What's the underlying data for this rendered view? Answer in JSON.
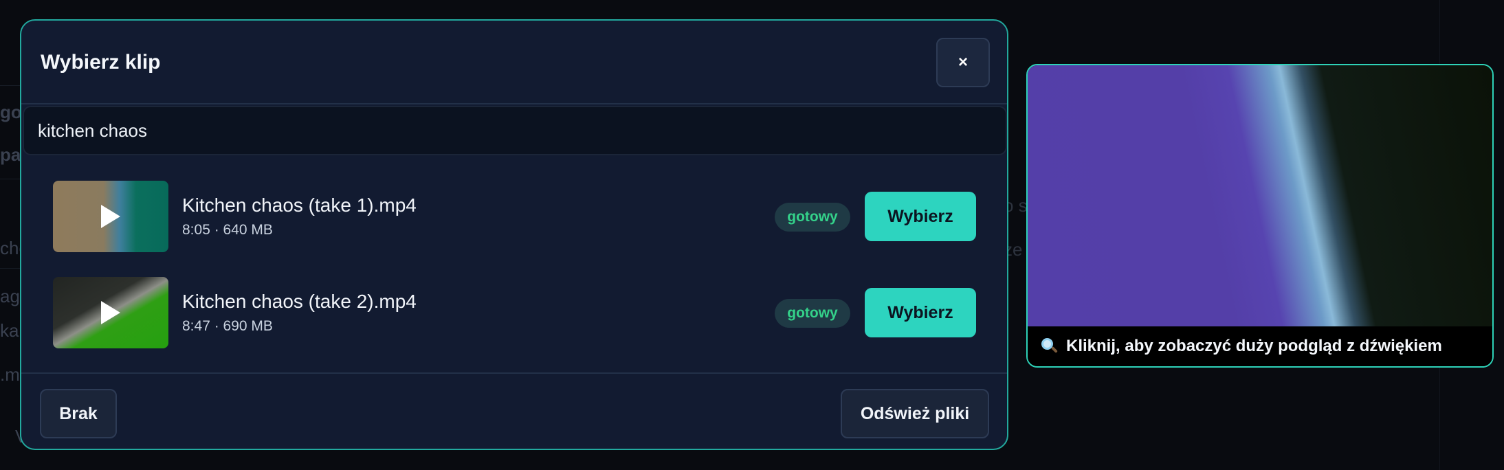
{
  "background": {
    "fragments": [
      "go",
      "pa",
      "che",
      "ag",
      "ka",
      ".m",
      "V"
    ],
    "right_fragments": [
      "o s",
      "ze"
    ]
  },
  "modal": {
    "title": "Wybierz klip",
    "close_label": "×",
    "search": {
      "value": "kitchen chaos",
      "placeholder": ""
    },
    "clips": [
      {
        "name": "Kitchen chaos (take 1).mp4",
        "meta": "8:05 · 640 MB",
        "status": "gotowy",
        "select_label": "Wybierz"
      },
      {
        "name": "Kitchen chaos (take 2).mp4",
        "meta": "8:47 · 690 MB",
        "status": "gotowy",
        "select_label": "Wybierz"
      }
    ],
    "footer": {
      "none_label": "Brak",
      "refresh_label": "Odśwież pliki"
    }
  },
  "preview": {
    "caption": "Kliknij, aby zobaczyć duży podgląd z dźwiękiem",
    "icon": "magnifier-icon"
  },
  "colors": {
    "accent": "#2dd4bf",
    "modal_border": "#22a99e",
    "status_text": "#34d28a",
    "modal_bg": "#121b31"
  }
}
